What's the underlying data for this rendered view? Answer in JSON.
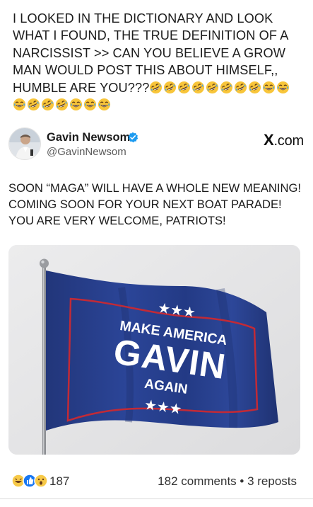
{
  "post": {
    "text": "I LOOKED IN THE DICTIONARY AND LOOK WHAT I FOUND, THE TRUE DEFINITION OF A NARCISSIST >> CAN YOU BELIEVE A GROW MAN WOULD POST THIS ABOUT HIMSELF,, HUMBLE ARE YOU???",
    "emojis": [
      "rolling-on-floor-laughing",
      "rolling-on-floor-laughing",
      "rolling-on-floor-laughing",
      "rolling-on-floor-laughing",
      "rolling-on-floor-laughing",
      "rolling-on-floor-laughing",
      "rolling-on-floor-laughing",
      "rolling-on-floor-laughing",
      "face-with-tears-of-joy",
      "face-with-tears-of-joy",
      "face-with-tears-of-joy",
      "rolling-on-floor-laughing",
      "rolling-on-floor-laughing",
      "rolling-on-floor-laughing",
      "face-with-tears-of-joy",
      "face-with-tears-of-joy",
      "face-with-tears-of-joy"
    ]
  },
  "embed": {
    "author_name": "Gavin Newsom",
    "handle": "@GavinNewsom",
    "source_x": "X",
    "source_suffix": ".com",
    "text": "SOON “MAGA” WILL HAVE A WHOLE NEW MEANING! COMING SOON FOR YOUR NEXT BOAT PARADE! YOU ARE VERY WELCOME, PATRIOTS!",
    "verified_color": "#1d9bf0"
  },
  "flag": {
    "stars_top": "★★★",
    "line1": "MAKE AMERICA",
    "line2": "GAVIN",
    "line3": "AGAIN",
    "stars_bottom": "★★★",
    "color": "#273f8c",
    "border_color": "#c22a36"
  },
  "footer": {
    "reaction_icons": [
      "laugh-reaction-icon",
      "thumbs-up-reaction-icon",
      "wow-reaction-icon"
    ],
    "reaction_count": "187",
    "stats": "182 comments • 3 reposts"
  }
}
